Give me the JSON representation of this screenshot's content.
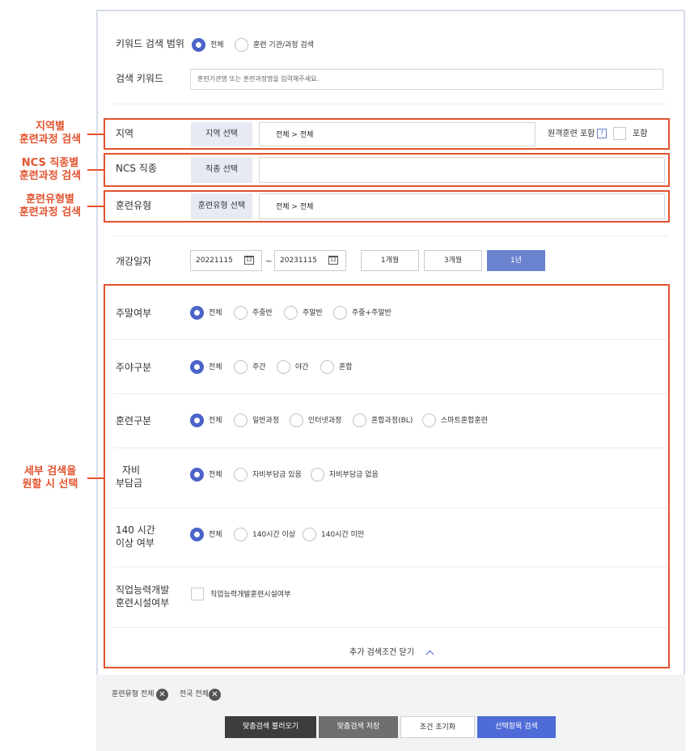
{
  "keyword_scope": {
    "label": "키워드 검색 범위",
    "options": [
      "전체",
      "훈련 기관/과정 검색"
    ],
    "selected": 0
  },
  "keyword": {
    "label": "검색 키워드",
    "placeholder": "훈련기관명 또는 훈련과정명을 입력해주세요."
  },
  "region": {
    "label": "지역",
    "button": "지역 선택",
    "value": "전체 > 전체",
    "remote_label": "원격훈련 포함",
    "help": "?",
    "include_label": "포함"
  },
  "ncs": {
    "label": "NCS 직종",
    "button": "직종 선택",
    "value": ""
  },
  "training_type": {
    "label": "훈련유형",
    "button": "훈련유형 선택",
    "value": "전체 > 전체"
  },
  "start_date": {
    "label": "개강일자",
    "from": "20221115",
    "to": "20231115",
    "separator": "~",
    "calendar_glyph": "12",
    "periods": [
      "1개월",
      "3개월",
      "1년"
    ],
    "selected_period": 2
  },
  "weekend": {
    "label": "주말여부",
    "options": [
      "전체",
      "주중반",
      "주말반",
      "주중+주말반"
    ],
    "selected": 0
  },
  "daynight": {
    "label": "주야구분",
    "options": [
      "전체",
      "주간",
      "야간",
      "혼합"
    ],
    "selected": 0
  },
  "training_class": {
    "label": "훈련구분",
    "options": [
      "전체",
      "일반과정",
      "인터넷과정",
      "혼합과정(BL)",
      "스마트혼합훈련"
    ],
    "selected": 0
  },
  "self_pay": {
    "label_line1": "자비",
    "label_line2": "부담금",
    "options": [
      "전체",
      "자비부담금 있음",
      "자비부담금 없음"
    ],
    "selected": 0
  },
  "hours140": {
    "label_line1": "140 시간",
    "label_line2": "이상 여부",
    "options": [
      "전체",
      "140시간 이상",
      "140시간 미만"
    ],
    "selected": 0
  },
  "facility": {
    "label_line1": "직업능력개발",
    "label_line2": "훈련시설여부",
    "checkbox_label": "직업능력개발훈련시설여부"
  },
  "close_more": "추가 검색조건 닫기",
  "tags": [
    {
      "label": "훈련유형 전체",
      "remove": "✕"
    },
    {
      "label": "전국 전체",
      "remove": "✕"
    }
  ],
  "actions": {
    "load": "맞춤검색 불러오기",
    "save": "맞춤검색 저장",
    "reset": "조건 초기화",
    "search": "선택항목 검색"
  },
  "annotations": {
    "region_line1": "지역별",
    "region_line2": "훈련과정 검색",
    "ncs_line1": "NCS 직종별",
    "ncs_line2": "훈련과정 검색",
    "type_line1": "훈련유형별",
    "type_line2": "훈련과정 검색",
    "detail_line1": "세부 검색을",
    "detail_line2": "원할 시 선택"
  },
  "colors": {
    "accent": "#4b63c9",
    "annotation": "#e2532f",
    "dark_button": "#3d3d3d",
    "gray_button": "#6f6f6f",
    "primary_button": "#4f6bd8"
  }
}
